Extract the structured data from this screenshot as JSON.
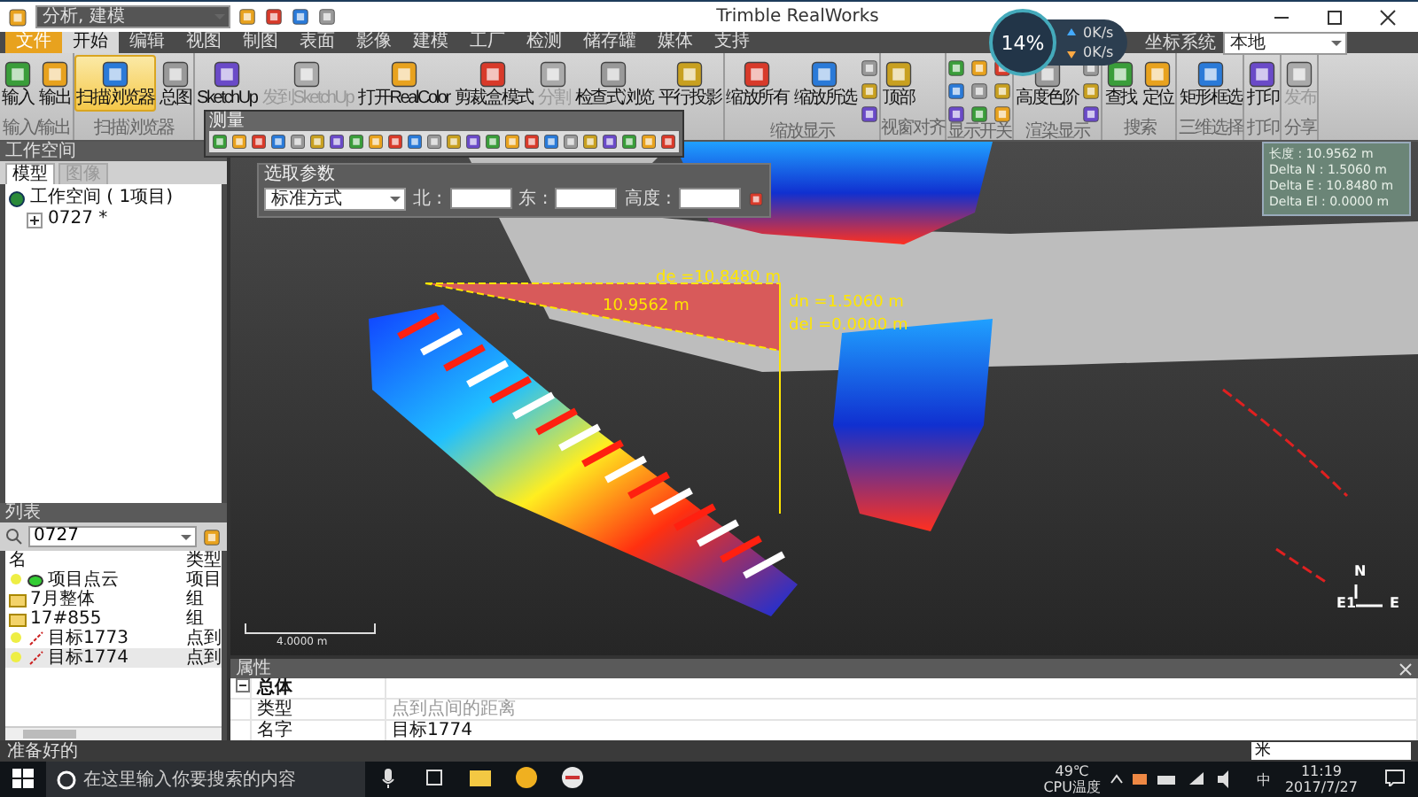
{
  "title_bar": {
    "workspace_combo": "分析, 建模",
    "title": "Trimble RealWorks"
  },
  "network_widget": {
    "cpu": "14%",
    "upload": "0K/s",
    "download": "0K/s"
  },
  "menu_tabs": [
    {
      "label": "文件",
      "kind": "file",
      "selected": false
    },
    {
      "label": "开始",
      "kind": "tab",
      "selected": true
    },
    {
      "label": "编辑",
      "kind": "tab",
      "selected": false
    },
    {
      "label": "视图",
      "kind": "tab",
      "selected": false
    },
    {
      "label": "制图",
      "kind": "tab",
      "selected": false
    },
    {
      "label": "表面",
      "kind": "tab",
      "selected": false
    },
    {
      "label": "影像",
      "kind": "tab",
      "selected": false
    },
    {
      "label": "建模",
      "kind": "tab",
      "selected": false
    },
    {
      "label": "工厂",
      "kind": "tab",
      "selected": false
    },
    {
      "label": "检测",
      "kind": "tab",
      "selected": false
    },
    {
      "label": "储存罐",
      "kind": "tab",
      "selected": false
    },
    {
      "label": "媒体",
      "kind": "tab",
      "selected": false
    },
    {
      "label": "支持",
      "kind": "tab",
      "selected": false
    }
  ],
  "coordinate_system": {
    "label": "坐标系统",
    "value": "本地"
  },
  "ribbon": [
    {
      "label": "输入/输出",
      "kind": "buttons",
      "buttons": [
        {
          "label": "输入",
          "active": false,
          "disabled": false
        },
        {
          "label": "输出",
          "active": false,
          "disabled": false
        }
      ]
    },
    {
      "label": "扫描浏览器",
      "kind": "buttons",
      "buttons": [
        {
          "label": "扫描浏览器",
          "active": true,
          "disabled": false
        },
        {
          "label": "总图",
          "active": false,
          "disabled": false
        }
      ]
    },
    {
      "kind": "buttons",
      "buttons": [
        {
          "label": "SketchUp",
          "active": false,
          "disabled": false
        },
        {
          "label": "发到SketchUp",
          "active": false,
          "disabled": true
        },
        {
          "label": "打开RealColor",
          "active": false,
          "disabled": false
        },
        {
          "label": "剪裁盒模式",
          "active": false,
          "disabled": false
        },
        {
          "label": "分割",
          "active": false,
          "disabled": true
        },
        {
          "label": "检查式浏览",
          "active": false,
          "disabled": false
        },
        {
          "label": "平行投影",
          "active": false,
          "disabled": false
        }
      ]
    },
    {
      "label": "缩放显示",
      "kind": "buttons_with_tools",
      "buttons": [
        {
          "label": "缩放所有",
          "active": false,
          "disabled": false
        },
        {
          "label": "缩放所选",
          "active": false,
          "disabled": false
        }
      ]
    },
    {
      "label": "视窗对齐",
      "kind": "buttons",
      "buttons": [
        {
          "label": "顶部",
          "active": false,
          "disabled": false
        }
      ]
    },
    {
      "label": "显示开关",
      "kind": "icon_grid"
    },
    {
      "label": "渲染显示",
      "kind": "buttons_with_tools",
      "buttons": [
        {
          "label": "高度色阶",
          "active": false,
          "disabled": false
        }
      ]
    },
    {
      "label": "搜索",
      "kind": "buttons",
      "buttons": [
        {
          "label": "查找",
          "active": false,
          "disabled": false
        },
        {
          "label": "定位",
          "active": false,
          "disabled": false
        }
      ]
    },
    {
      "label": "三维选择",
      "kind": "buttons",
      "buttons": [
        {
          "label": "矩形框选",
          "active": false,
          "disabled": false
        }
      ]
    },
    {
      "label": "打印",
      "kind": "buttons",
      "buttons": [
        {
          "label": "打印",
          "active": false,
          "disabled": false
        }
      ]
    },
    {
      "label": "分享",
      "kind": "buttons",
      "buttons": [
        {
          "label": "发布",
          "active": false,
          "disabled": true
        }
      ]
    }
  ],
  "measure_toolbar": {
    "title": "测量"
  },
  "workspace": {
    "title": "工作空间",
    "tabs": [
      {
        "label": "模型",
        "selected": true
      },
      {
        "label": "图像",
        "selected": false
      }
    ],
    "tree": [
      {
        "label": "工作空间 ( 1项目)",
        "children": [
          {
            "label": "0727 *",
            "expanded": false
          }
        ]
      }
    ]
  },
  "list_panel": {
    "title": "列表",
    "search_value": "0727",
    "columns": [
      "名",
      "类型"
    ],
    "rows": [
      {
        "name": "项目点云",
        "type": "项目",
        "kind": "cloud",
        "selected": false
      },
      {
        "name": "7月整体",
        "type": "组",
        "kind": "folder",
        "selected": false
      },
      {
        "name": "17#855",
        "type": "组",
        "kind": "folder",
        "selected": false
      },
      {
        "name": "目标1773",
        "type": "点到",
        "kind": "measure",
        "selected": false
      },
      {
        "name": "目标1774",
        "type": "点到",
        "kind": "measure",
        "selected": true
      }
    ]
  },
  "pick_params": {
    "title": "选取参数",
    "mode": "标准方式",
    "fields": [
      {
        "label": "北 :"
      },
      {
        "label": "东 :"
      },
      {
        "label": "高度 :"
      }
    ]
  },
  "measurement": {
    "de": "de =10.8480 m",
    "length": "10.9562 m",
    "dn": "dn =1.5060 m",
    "dh": "del =0.0000 m"
  },
  "info_box": [
    "长度 : 10.9562 m",
    "Delta N : 1.5060 m",
    "Delta E : 10.8480 m",
    "Delta El : 0.0000 m"
  ],
  "scale_bar": "4.0000 m",
  "compass": {
    "north": "N",
    "east": "E",
    "marker": "E1"
  },
  "properties": {
    "title": "属性",
    "group": "总体",
    "rows": [
      {
        "key": "类型",
        "value": "点到点间的距离",
        "muted": true
      },
      {
        "key": "名字",
        "value": "目标1774",
        "muted": false
      }
    ]
  },
  "status_bar": {
    "text": "准备好的",
    "unit": "米"
  },
  "taskbar": {
    "search_placeholder": "在这里输入你要搜索的内容",
    "temperature": "49℃",
    "temperature_label": "CPU温度",
    "ime": "中",
    "time": "11:19",
    "date": "2017/7/27"
  }
}
